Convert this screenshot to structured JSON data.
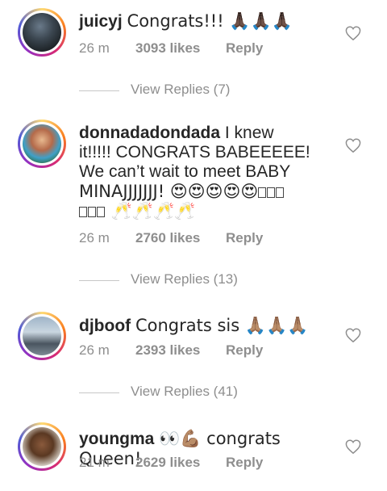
{
  "colors": {
    "text": "#262626",
    "meta": "#8e8e8e",
    "divider": "#c7c7c7",
    "story_ring": [
      "#feda75",
      "#fa7e1e",
      "#d62976",
      "#962fbf",
      "#4f5bd5"
    ]
  },
  "comments": [
    {
      "username": "juicyj",
      "text": "Congrats!!! 🙏🏿🙏🏿🙏🏿",
      "time": "26 m",
      "likes": "3093 likes",
      "reply_label": "Reply",
      "view_replies": "View Replies (7)"
    },
    {
      "username": "donnadadondada",
      "text_lines": [
        "I knew",
        "it!!!!! CONGRATS BABEEEEE!",
        "We can’t wait to meet BABY",
        "MINAJJJJJJJ! 😍😍😍😍😍"
      ],
      "text_line5_suffix": "🥂🥂🥂🥂",
      "time": "26 m",
      "likes": "2760 likes",
      "reply_label": "Reply",
      "view_replies": "View Replies (13)"
    },
    {
      "username": "djboof",
      "text": "Congrats sis 🙏🏽🙏🏽🙏🏽",
      "time": "26 m",
      "likes": "2393 likes",
      "reply_label": "Reply",
      "view_replies": "View Replies (41)"
    },
    {
      "username": "youngma",
      "text": "👀💪🏽 congrats Queen!",
      "time": "21 m",
      "likes": "2629 likes",
      "reply_label": "Reply"
    }
  ],
  "icons": {
    "like": "heart-outline-icon"
  }
}
